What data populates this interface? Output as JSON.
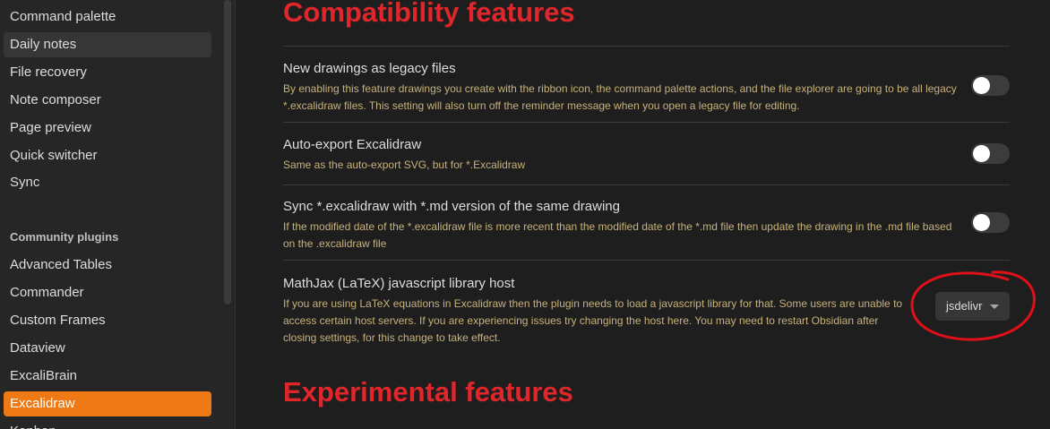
{
  "sidebar": {
    "items": [
      {
        "label": "Command palette"
      },
      {
        "label": "Daily notes"
      },
      {
        "label": "File recovery"
      },
      {
        "label": "Note composer"
      },
      {
        "label": "Page preview"
      },
      {
        "label": "Quick switcher"
      },
      {
        "label": "Sync"
      }
    ],
    "community_heading": "Community plugins",
    "community_items": [
      {
        "label": "Advanced Tables"
      },
      {
        "label": "Commander"
      },
      {
        "label": "Custom Frames"
      },
      {
        "label": "Dataview"
      },
      {
        "label": "ExcaliBrain"
      },
      {
        "label": "Excalidraw"
      },
      {
        "label": "Kanban"
      }
    ],
    "selected_item": "Daily notes",
    "active_item": "Excalidraw"
  },
  "main": {
    "compat_heading": "Compatibility features",
    "settings": [
      {
        "name": "New drawings as legacy files",
        "desc": "By enabling this feature drawings you create with the ribbon icon, the command palette actions, and the file explorer are going to be all legacy *.excalidraw files. This setting will also turn off the reminder message when you open a legacy file for editing.",
        "toggle_on": false
      },
      {
        "name": "Auto-export Excalidraw",
        "desc": "Same as the auto-export SVG, but for *.Excalidraw",
        "toggle_on": false
      },
      {
        "name": "Sync *.excalidraw with *.md version of the same drawing",
        "desc": "If the modified date of the *.excalidraw file is more recent than the modified date of the *.md file then update the drawing in the .md file based on the .excalidraw file",
        "toggle_on": false
      },
      {
        "name": "MathJax (LaTeX) javascript library host",
        "desc": "If you are using LaTeX equations in Excalidraw then the plugin needs to load a javascript library for that. Some users are unable to access certain host servers. If you are experiencing issues try changing the host here. You may need to restart Obsidian after closing settings, for this change to take effect.",
        "dropdown_value": "jsdelivr"
      }
    ],
    "experimental_heading": "Experimental features"
  },
  "colors": {
    "heading_red": "#e0262b",
    "accent_orange": "#ef7a15",
    "annotation_red": "#e0101a"
  }
}
